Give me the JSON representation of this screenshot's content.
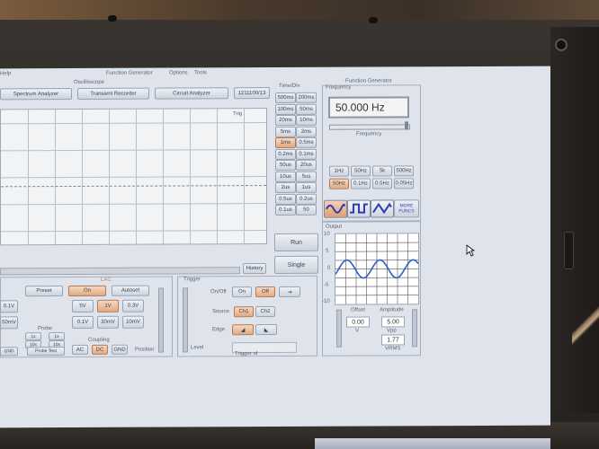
{
  "menubar": {
    "help": "Help",
    "title": "Function Generator",
    "options": "Options",
    "tools": "Tools"
  },
  "oscilloscope": {
    "section_label": "Oscilloscope",
    "tabs": [
      "Spectrum Analyzer",
      "Transient Recorder",
      "Circuit Analyzer",
      "1211100/13"
    ],
    "trig_label": "Trig",
    "history": "History",
    "channel": {
      "label": "LAC",
      "preset": "Preset",
      "on": "On",
      "autoset": "Autoset",
      "volts": [
        "5V",
        "1V",
        "0.3V",
        "0.1V",
        "30mV",
        "10mV"
      ],
      "left_labels": [
        "0.1V",
        "50mV"
      ],
      "probe": "Probe",
      "probe_values": [
        "1x",
        "1x",
        "10x",
        "10x"
      ],
      "probe_test": "Probe Test",
      "coupling": "Coupling",
      "coupling_opts": [
        "AC",
        "DC",
        "GND"
      ],
      "position": "Position",
      "gnd_left": "GND"
    }
  },
  "timediv": {
    "label": "Time/Div",
    "buttons": [
      "500ms",
      "200ms",
      "100ms",
      "50ms",
      "20ms",
      "10ms",
      "5ms",
      "2ms",
      "1ms",
      "0.5ms",
      "0.2ms",
      "0.1ms",
      "50us",
      "20us",
      "10us",
      "5us",
      "2us",
      "1us",
      "0.5us",
      "0.2us",
      "0.1us",
      "50"
    ],
    "selected": "1ms",
    "run": "Run",
    "single": "Single"
  },
  "trigger": {
    "label": "Trigger",
    "onoff": "On/Off",
    "on": "On",
    "off": "Off",
    "source": "Source",
    "ch1": "Ch1",
    "ch2": "Ch2",
    "edge": "Edge",
    "level": "Level",
    "trigger_of": "Trigger of"
  },
  "funcgen": {
    "section_label": "Function Generator",
    "frequency_label": "Frequency",
    "display": "50.000 Hz",
    "freq_caption": "Frequency",
    "ranges": [
      "1Hz",
      "50Hz",
      "5k",
      "500Hz",
      "50Hz",
      "0.1Hz",
      "0.5Hz",
      "0.05Hz"
    ],
    "more": "MORE FUNCS",
    "output_label": "Output",
    "y_ticks": [
      "10",
      "5",
      "0",
      "-5",
      "-10"
    ],
    "offset_label": "Offset",
    "offset_value": "0.00",
    "offset_unit": "V",
    "amplitude_label": "Amplitude",
    "amplitude_value": "5.00",
    "amplitude_unit": "Vpp",
    "vrms_value": "1.77",
    "vrms_unit": "VRMS"
  }
}
